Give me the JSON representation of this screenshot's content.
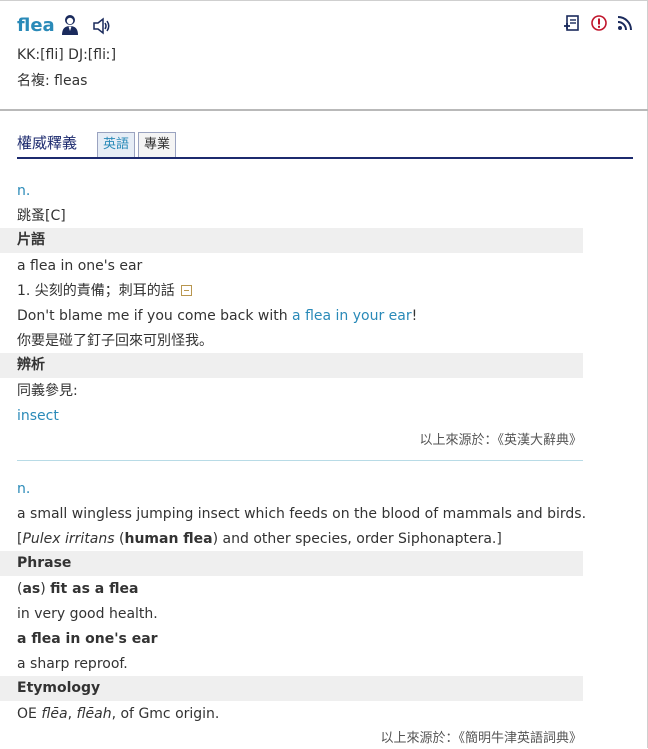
{
  "header": {
    "word": "flea",
    "pronunciation": "KK:[fli] DJ:[fliː]",
    "plural": "名複: fleas",
    "icons": [
      "person-icon",
      "speaker-icon",
      "word-list-icon",
      "report-icon",
      "rss-icon"
    ]
  },
  "tabs": {
    "title": "權威釋義",
    "items": [
      {
        "label": "英語"
      },
      {
        "label": "專業"
      }
    ]
  },
  "section1": {
    "pos": "n.",
    "definition": "跳蚤[C]",
    "phrase_header": "片語",
    "phrase": "a flea in one's ear",
    "phrase_meaning": "1. 尖刻的責備；刺耳的話",
    "example_before": "Don't blame me if you come back with ",
    "example_highlight": "a flea in your ear",
    "example_after": "!",
    "example_translation": "你要是碰了釘子回來可別怪我。",
    "analysis_header": "辨析",
    "synonym_label": "同義參見:",
    "synonym_link": "insect",
    "source": "以上來源於：《英漢大辭典》"
  },
  "section2": {
    "pos": "n.",
    "definition": "a small wingless jumping insect which feeds on the blood of mammals and birds.",
    "bracket_open": "[",
    "latin": "Pulex irritans",
    "paren_open": " (",
    "common": "human flea",
    "rest": ") and other species, order Siphonaptera.]",
    "phrase_header": "Phrase",
    "phrase1_paren_open": "(",
    "phrase1_as": "as",
    "phrase1_paren_close": ") ",
    "phrase1_rest": "fit as a flea",
    "phrase1_meaning": "in very good health.",
    "phrase2": "a flea in one's ear",
    "phrase2_meaning": "a sharp reproof.",
    "etymology_header": "Etymology",
    "etym_oe": "OE ",
    "etym_form1": "flēa",
    "etym_comma": ", ",
    "etym_form2": "flēah",
    "etym_rest": ", of Gmc origin.",
    "source": "以上來源於：《簡明牛津英語詞典》"
  },
  "colors": {
    "accent": "#2a8ab8",
    "navy": "#1c2a6e",
    "header_band": "#efefef"
  }
}
